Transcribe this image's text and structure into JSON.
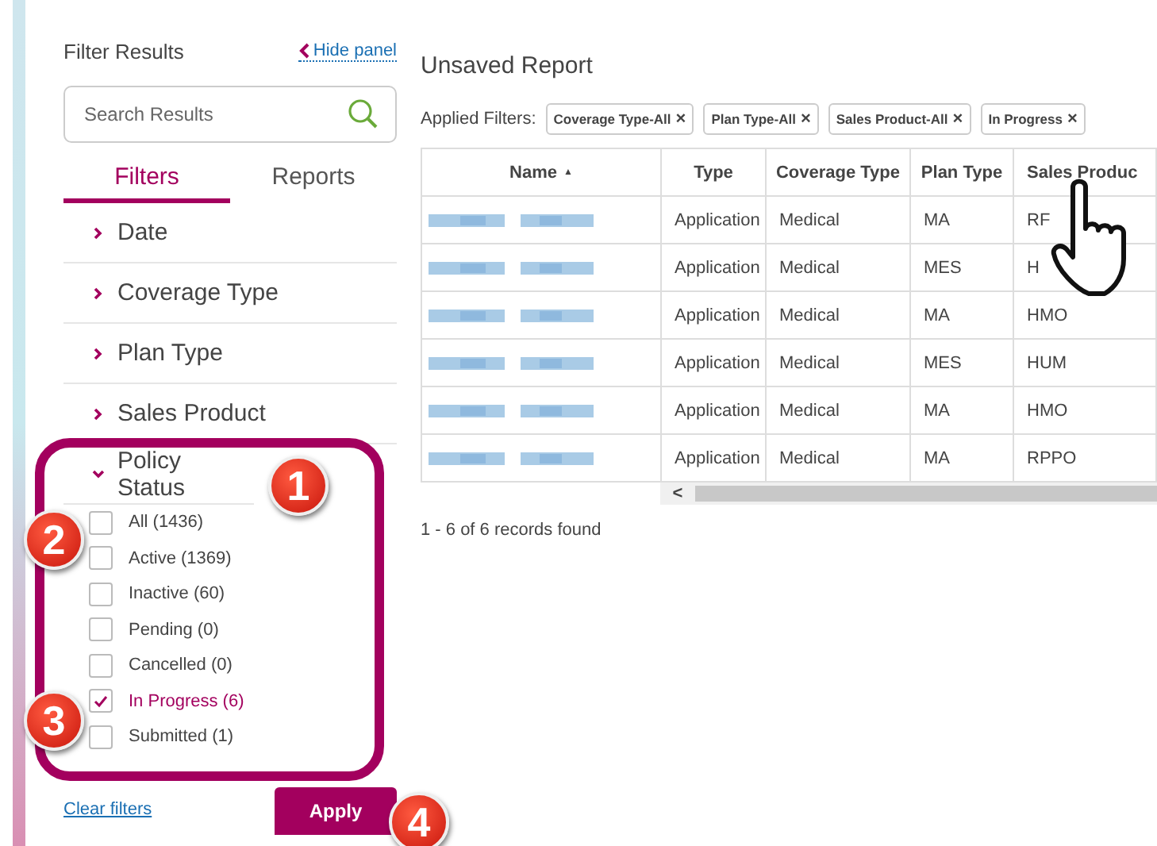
{
  "sidebar": {
    "title": "Filter Results",
    "hide_link": "Hide panel",
    "search": {
      "placeholder": "Search Results"
    },
    "tabs": [
      {
        "label": "Filters",
        "selected": true
      },
      {
        "label": "Reports",
        "selected": false
      }
    ],
    "sections": [
      {
        "label": "Date",
        "expanded": false
      },
      {
        "label": "Coverage Type",
        "expanded": false
      },
      {
        "label": "Plan Type",
        "expanded": false
      },
      {
        "label": "Sales Product",
        "expanded": false
      },
      {
        "label": "Policy Status",
        "expanded": true,
        "options": [
          {
            "label": "All (1436)",
            "checked": false
          },
          {
            "label": "Active (1369)",
            "checked": false
          },
          {
            "label": "Inactive (60)",
            "checked": false
          },
          {
            "label": "Pending (0)",
            "checked": false
          },
          {
            "label": "Cancelled (0)",
            "checked": false
          },
          {
            "label": "In Progress (6)",
            "checked": true
          },
          {
            "label": "Submitted (1)",
            "checked": false
          }
        ]
      }
    ],
    "clear_link": "Clear filters",
    "apply_button": "Apply"
  },
  "report": {
    "title": "Unsaved Report",
    "filters_label": "Applied Filters:",
    "filter_chips": [
      {
        "label": "Coverage Type-All",
        "remove": "×"
      },
      {
        "label": "Plan Type-All",
        "remove": "×"
      },
      {
        "label": "Sales Product-All",
        "remove": "×"
      },
      {
        "label": "In Progress",
        "remove": "×"
      }
    ],
    "table": {
      "columns": [
        {
          "label": "Name",
          "sort": "▲"
        },
        {
          "label": "Type"
        },
        {
          "label": "Coverage Type"
        },
        {
          "label": "Plan Type"
        },
        {
          "label": "Sales Produc"
        }
      ],
      "rows": [
        [
          "",
          "Application",
          "Medical",
          "MA",
          "RF"
        ],
        [
          "",
          "Application",
          "Medical",
          "MES",
          "H"
        ],
        [
          "",
          "Application",
          "Medical",
          "MA",
          "HMO"
        ],
        [
          "",
          "Application",
          "Medical",
          "MES",
          "HUM"
        ],
        [
          "",
          "Application",
          "Medical",
          "MA",
          "HMO"
        ],
        [
          "",
          "Application",
          "Medical",
          "MA",
          "RPPO"
        ]
      ],
      "scroll_left": "<"
    },
    "records": "1 - 6 of 6 records found"
  },
  "callouts": [
    {
      "label": "1"
    },
    {
      "label": "2"
    },
    {
      "label": "3"
    },
    {
      "label": "4"
    }
  ]
}
